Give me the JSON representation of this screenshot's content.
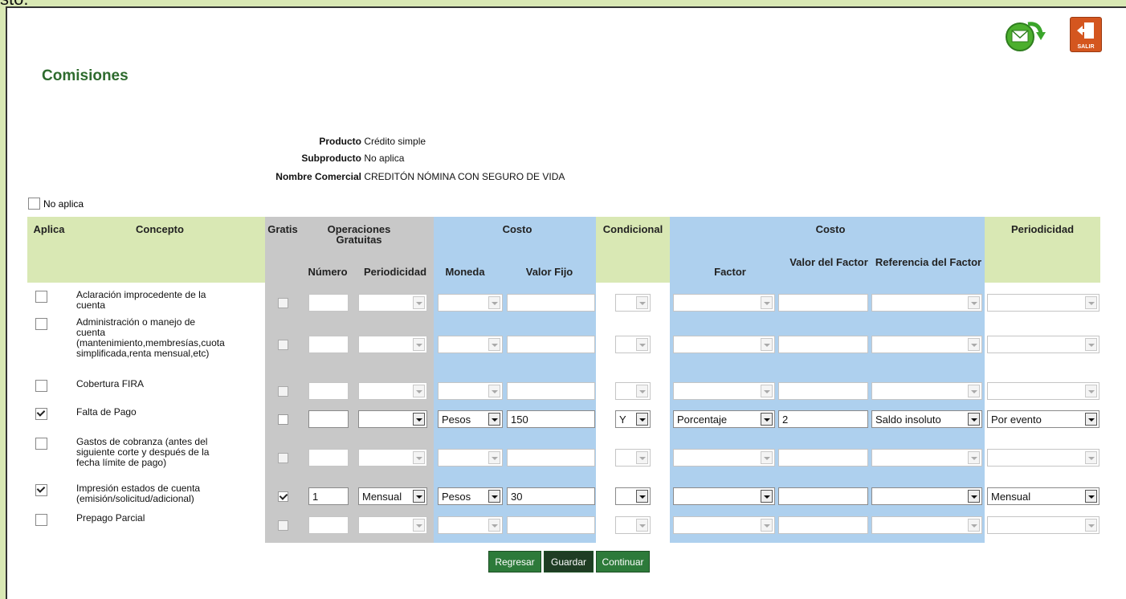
{
  "top_fragment": "sto.",
  "header": {
    "title": "Comisiones",
    "mail_icon": "mail-forward-icon",
    "exit_icon": "exit-door-icon",
    "exit_label": "SALIR"
  },
  "product_info": [
    {
      "key": "Producto",
      "value": "Crédito simple"
    },
    {
      "key": "Subproducto",
      "value": "No aplica"
    },
    {
      "key": "Nombre Comercial",
      "value": "CREDITÓN NÓMINA CON SEGURO DE VIDA"
    }
  ],
  "no_aplica_label": "No aplica",
  "columns": {
    "aplica": "Aplica",
    "concepto": "Concepto",
    "gratis": "Gratis",
    "operaciones_gratuitas": "Operaciones Gratuitas",
    "numero": "Número",
    "periodicidad_op": "Periodicidad",
    "costo": "Costo",
    "moneda": "Moneda",
    "valor_fijo": "Valor Fijo",
    "condicional": "Condicional",
    "costo2": "Costo",
    "factor": "Factor",
    "valor_factor": "Valor del Factor",
    "referencia_factor": "Referencia del Factor",
    "periodicidad": "Periodicidad"
  },
  "rows": [
    {
      "lines": [
        "Aclaración improcedente de la",
        "cuenta"
      ],
      "aplica": false,
      "gratis": false,
      "numero": "",
      "periodicidad_op": "",
      "moneda": "",
      "valor_fijo": "",
      "condicional": "",
      "factor": "",
      "valor_factor": "",
      "referencia": "",
      "periodicidad": ""
    },
    {
      "lines": [
        "Administración o manejo de",
        "cuenta",
        "(mantenimiento,membresías,cuota",
        "simplificada,renta mensual,etc)"
      ],
      "aplica": false,
      "gratis": false,
      "numero": "",
      "periodicidad_op": "",
      "moneda": "",
      "valor_fijo": "",
      "condicional": "",
      "factor": "",
      "valor_factor": "",
      "referencia": "",
      "periodicidad": ""
    },
    {
      "lines": [
        "Cobertura FIRA"
      ],
      "aplica": false,
      "gratis": false,
      "numero": "",
      "periodicidad_op": "",
      "moneda": "",
      "valor_fijo": "",
      "condicional": "",
      "factor": "",
      "valor_factor": "",
      "referencia": "",
      "periodicidad": ""
    },
    {
      "lines": [
        "Falta de Pago"
      ],
      "aplica": true,
      "gratis": false,
      "numero": "",
      "periodicidad_op": "",
      "moneda": "Pesos",
      "valor_fijo": "150",
      "condicional": "Y",
      "factor": "Porcentaje",
      "valor_factor": "2",
      "referencia": "Saldo insoluto",
      "periodicidad": "Por evento"
    },
    {
      "lines": [
        "Gastos de cobranza (antes del",
        "siguiente corte y después de la",
        "fecha límite de pago)"
      ],
      "aplica": false,
      "gratis": false,
      "numero": "",
      "periodicidad_op": "",
      "moneda": "",
      "valor_fijo": "",
      "condicional": "",
      "factor": "",
      "valor_factor": "",
      "referencia": "",
      "periodicidad": ""
    },
    {
      "lines": [
        "Impresión estados de cuenta",
        "(emisión/solicitud/adicional)"
      ],
      "aplica": true,
      "gratis": true,
      "numero": "1",
      "periodicidad_op": "Mensual",
      "moneda": "Pesos",
      "valor_fijo": "30",
      "condicional": "",
      "factor": "",
      "valor_factor": "",
      "referencia": "",
      "periodicidad": "Mensual"
    },
    {
      "lines": [
        "Prepago Parcial"
      ],
      "aplica": false,
      "gratis": false,
      "numero": "",
      "periodicidad_op": "",
      "moneda": "",
      "valor_fijo": "",
      "condicional": "",
      "factor": "",
      "valor_factor": "",
      "referencia": "",
      "periodicidad": ""
    }
  ],
  "buttons": {
    "regresar": "Regresar",
    "guardar": "Guardar",
    "continuar": "Continuar"
  },
  "colors": {
    "panel_bg": "#d9e8b4",
    "accent_green": "#2e6b2e",
    "blue_band": "#aed0ee",
    "gray_band": "#c8c8c8"
  }
}
